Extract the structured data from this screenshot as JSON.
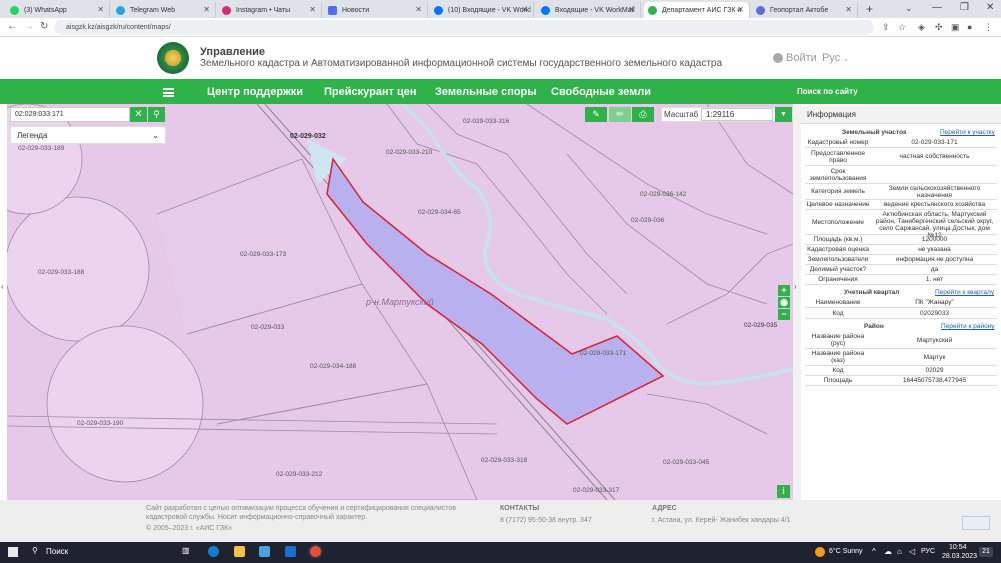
{
  "browser": {
    "tabs": [
      {
        "title": "(3) WhatsApp",
        "color": "#25d366"
      },
      {
        "title": "Telegram Web",
        "color": "#2aa3de"
      },
      {
        "title": "Instagram • Чаты",
        "color": "#d62976"
      },
      {
        "title": "Новости",
        "color": "#4c6ef5"
      },
      {
        "title": "(10) Входящие - VK Workl",
        "color": "#0077ff"
      },
      {
        "title": "Входящие - VK WorkMail",
        "color": "#0077ff"
      },
      {
        "title": "Департамент АИС ГЗК и",
        "color": "#2fb24a"
      },
      {
        "title": "Геопортал Актобе",
        "color": "#5a6fd6"
      }
    ],
    "url": "aisgzk.kz/aisgzk/ru/content/maps/"
  },
  "header": {
    "title_line1": "Управление",
    "title_line2": "Земельного кадастра и Автоматизированной информационной системы государственного земельного кадастра",
    "login": "Войти",
    "lang": "Рус"
  },
  "nav": {
    "items": [
      "Центр поддержки",
      "Прейскурант цен",
      "Земельные споры",
      "Свободные земли"
    ],
    "search": "Поиск по сайту"
  },
  "map": {
    "search_value": "02:029:033:171",
    "legend_label": "Легенда",
    "scale_label": "Масштаб",
    "scale_value": "1:29116",
    "district_label": "р-н.Мартукский",
    "parcel_labels": [
      "02-029-032",
      "02-029-033-210",
      "02-029-033-316",
      "02-029-033-171",
      "02-029-036-142",
      "02-029-036",
      "02-029-033-173",
      "02-029-033",
      "02-029-034-188",
      "02-029-033-188",
      "02-029-033-190",
      "02-029-033-212",
      "02-029-033-318",
      "02-029-033-317",
      "02-029-033-045",
      "02-029-035",
      "02-029-033-189",
      "02-029-034-65"
    ]
  },
  "panel": {
    "title": "Информация",
    "land": {
      "header": "Земельный участок",
      "link": "Перейти к участку",
      "rows": [
        {
          "k": "Кадастровый номер",
          "v": "02-029-033-171"
        },
        {
          "k": "Предоставленное право",
          "v": "частная собственность"
        },
        {
          "k": "Срок землепользования",
          "v": ""
        },
        {
          "k": "Категория земель",
          "v": "Земли сельскохозяйственного назначения"
        },
        {
          "k": "Целевое назначение",
          "v": "ведение крестьянского хозяйства"
        },
        {
          "k": "Местоположение",
          "v": "Актюбинская область, Мартукский район, Танибергенский сельский округ, село Саржансай, улица Достык, дом №12"
        },
        {
          "k": "Площадь (кв.м.)",
          "v": "1200000"
        },
        {
          "k": "Кадастровая оценка",
          "v": "не указана"
        },
        {
          "k": "Землепользователи",
          "v": "информация не доступна"
        },
        {
          "k": "Делимый участок?",
          "v": "да"
        },
        {
          "k": "Ограничения",
          "v": "1. нет"
        }
      ]
    },
    "quarter": {
      "header": "Учетный квартал",
      "link": "Перейти к кварталу",
      "rows": [
        {
          "k": "Наименование",
          "v": "ПК \"Жанару\""
        },
        {
          "k": "Код",
          "v": "02029033"
        }
      ]
    },
    "district": {
      "header": "Район",
      "link": "Перейти к району",
      "rows": [
        {
          "k": "Название района (рус)",
          "v": "Мартукский"
        },
        {
          "k": "Название района (каз)",
          "v": "Мартук"
        },
        {
          "k": "Код",
          "v": "02029"
        },
        {
          "k": "Площадь",
          "v": "16445075738,477945"
        }
      ]
    }
  },
  "footer": {
    "about_line1": "Сайт разработан с целью оптимизации процесса обучения и сертифицирования специалистов",
    "about_line2": "кадастровой службы. Носит информационно-справочный характер.",
    "copyright": "© 2005–2023 г. «АИС ГЗК»",
    "contacts_title": "КОНТАКТЫ",
    "contacts": "8 (7172) 95-50-38 внутр. 347",
    "address_title": "АДРЕС",
    "address": "г. Астана, ул. Керей- Жанибек хандары 4/1"
  },
  "taskbar": {
    "search": "Поиск",
    "weather": "6°C Sunny",
    "lang": "РУС",
    "time": "10:54",
    "date": "28.03.2023",
    "notif": "21"
  },
  "colors": {
    "green": "#2fb24a",
    "map_bg": "#e6c8e8",
    "parcel_fill": "#b9b1ef",
    "parcel_stroke": "#d9232e"
  }
}
